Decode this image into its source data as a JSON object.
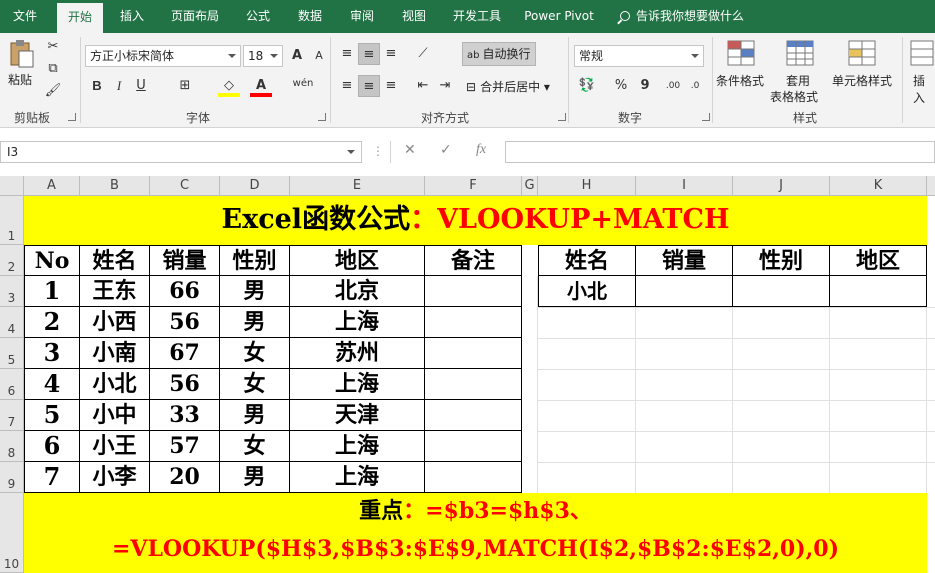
{
  "tabs": [
    "文件",
    "开始",
    "插入",
    "页面布局",
    "公式",
    "数据",
    "审阅",
    "视图",
    "开发工具",
    "Power Pivot"
  ],
  "active_tab": "开始",
  "tell_me": "告诉我你想要做什么",
  "ribbon": {
    "clipboard": {
      "paste": "粘贴",
      "label": "剪贴板"
    },
    "font": {
      "name": "方正小标宋简体",
      "size": "18",
      "bold": "B",
      "italic": "I",
      "underline": "U",
      "grow": "A",
      "shrink": "A",
      "phonetic": "wén",
      "label": "字体"
    },
    "alignment": {
      "wrap": "自动换行",
      "merge": "合并后居中",
      "label": "对齐方式"
    },
    "number": {
      "format": "常规",
      "percent": "%",
      "comma": "9",
      "label": "数字"
    },
    "styles": {
      "conditional": "条件格式",
      "table1": "套用",
      "table2": "表格格式",
      "cell_styles": "单元格样式",
      "label": "样式"
    },
    "cells": {
      "insert": "插入"
    }
  },
  "formula_bar": {
    "name_box": "I3",
    "cancel": "✕",
    "enter": "✓",
    "fx": "fx",
    "content": ""
  },
  "columns": [
    "A",
    "B",
    "C",
    "D",
    "E",
    "F",
    "G",
    "H",
    "I",
    "J",
    "K"
  ],
  "rows": [
    "1",
    "2",
    "3",
    "4",
    "5",
    "6",
    "7",
    "8",
    "9",
    "10"
  ],
  "sheet": {
    "title_black": "Excel函数公式",
    "title_red": "：VLOOKUP+MATCH",
    "headers": [
      "No",
      "姓名",
      "销量",
      "性别",
      "地区",
      "备注"
    ],
    "data": [
      [
        "1",
        "王东",
        "66",
        "男",
        "北京",
        ""
      ],
      [
        "2",
        "小西",
        "56",
        "男",
        "上海",
        ""
      ],
      [
        "3",
        "小南",
        "67",
        "女",
        "苏州",
        ""
      ],
      [
        "4",
        "小北",
        "56",
        "女",
        "上海",
        ""
      ],
      [
        "5",
        "小中",
        "33",
        "男",
        "天津",
        ""
      ],
      [
        "6",
        "小王",
        "57",
        "女",
        "上海",
        ""
      ],
      [
        "7",
        "小李",
        "20",
        "男",
        "上海",
        ""
      ]
    ],
    "lookup_headers": [
      "姓名",
      "销量",
      "性别",
      "地区"
    ],
    "lookup_values": [
      "小北",
      "",
      "",
      ""
    ],
    "note_black": "重点",
    "note_red": "：=$b3=$h$3、",
    "formula": "=VLOOKUP($H$3,$B$3:$E$9,MATCH(I$2,$B$2:$E$2,0),0)"
  },
  "colors": {
    "excel_green": "#217346",
    "yellow": "#ffff00",
    "red": "#ff0000"
  }
}
